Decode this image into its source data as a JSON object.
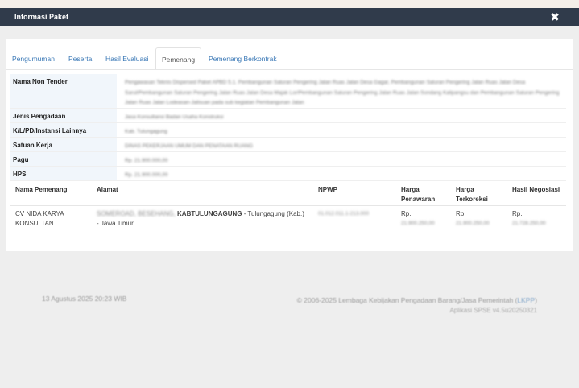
{
  "modal": {
    "title": "Informasi Paket",
    "close_glyph": "✖"
  },
  "tabs": [
    {
      "label": "Pengumuman"
    },
    {
      "label": "Peserta"
    },
    {
      "label": "Hasil Evaluasi"
    },
    {
      "label": "Pemenang"
    },
    {
      "label": "Pemenang Berkontrak"
    }
  ],
  "active_tab": "Pemenang",
  "info": {
    "nama_non_tender": {
      "label": "Nama Non Tender",
      "value": "Pengawasan Teknis Dispersed Paket APBD 5.1. Pembangunan Saluran Pengering Jalan Ruas Jalan Desa Gagar, Pembangunan Saluran Pengering Jalan Ruas Jalan Desa Sarul/Pembangunan Saluran Pengering Jalan Ruas Jalan Desa Majak Lor/Pembangunan Saluran Pengering Jalan Ruas Jalan Sondang Kalipangsu dan Pembangunan Saluran Pengering Jalan Ruas Jalan Lodeasan-Jalisuan pada sub kegiatan Pembangunan Jalan"
    },
    "jenis_pengadaan": {
      "label": "Jenis Pengadaan",
      "value": "Jasa Konsultansi Badan Usaha Konstruksi"
    },
    "klpd": {
      "label": "K/L/PD/Instansi Lainnya",
      "value": "Kab. Tulungagung"
    },
    "satuan_kerja": {
      "label": "Satuan Kerja",
      "value": "DINAS PEKERJAAN UMUM DAN PENATAAN RUANG"
    },
    "pagu": {
      "label": "Pagu",
      "value": "Rp. 21.900.000,00"
    },
    "hps": {
      "label": "HPS",
      "value": "Rp. 21.900.000,00"
    }
  },
  "winner_table": {
    "headers": {
      "nama": "Nama Pemenang",
      "alamat": "Alamat",
      "npwp": "NPWP",
      "harga_penawaran_1": "Harga",
      "harga_penawaran_2": "Penawaran",
      "harga_terkoreksi_1": "Harga",
      "harga_terkoreksi_2": "Terkoreksi",
      "hasil_negosiasi": "Hasil Negosiasi"
    },
    "rows": [
      {
        "nama_1": "CV NIDA KARYA",
        "nama_2": "KONSULTAN",
        "alamat_blurred": "SOMEROAD, BESEHANG,",
        "alamat_city": "KABTULUNGAGUNG",
        "alamat_rest": " - Tulungagung (Kab.)",
        "alamat_line2": "- Jawa Timur",
        "npwp": "01.012.011.1-213.000",
        "rp": "Rp.",
        "harga_penawaran": "21.900.250,00",
        "harga_terkoreksi": "21.900.250,00",
        "hasil_negosiasi": "21.728.250,00"
      }
    ]
  },
  "footer": {
    "date": "13 Agustus 2025 20:23 WIB",
    "copyright_prefix": "© 2006-2025 Lembaga Kebijakan Pengadaan Barang/Jasa Pemerintah (",
    "copyright_link": "LKPP",
    "copyright_suffix": ")",
    "app_version": "Aplikasi SPSE v4.5u20250321"
  }
}
